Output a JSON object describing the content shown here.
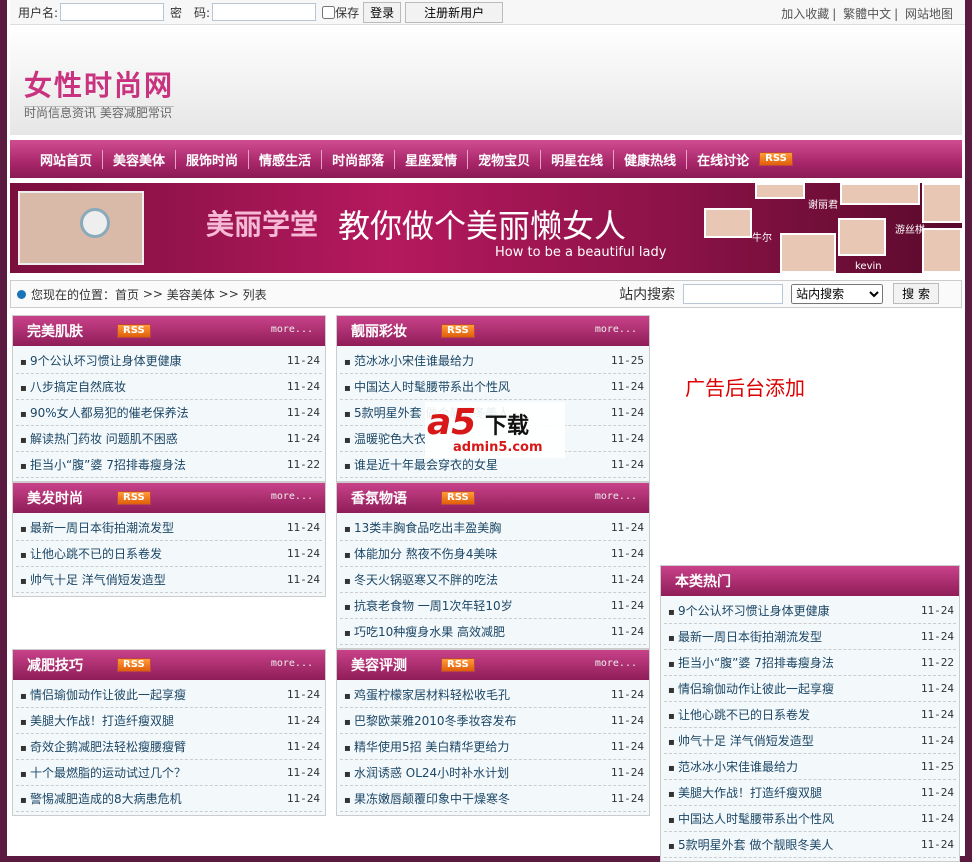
{
  "topbar": {
    "username_label": "用户名:",
    "password_label": "密　码:",
    "remember_label": "保存",
    "login": "登录",
    "register": "注册新用户",
    "links": [
      "加入收藏",
      "繁體中文",
      "网站地图"
    ]
  },
  "header": {
    "logo": "女性时尚网",
    "slogan": "时尚信息资讯 美容减肥常识"
  },
  "nav": {
    "items": [
      "网站首页",
      "美容美体",
      "服饰时尚",
      "情感生活",
      "时尚部落",
      "星座爱情",
      "宠物宝贝",
      "明星在线",
      "健康热线",
      "在线讨论"
    ],
    "rss": "RSS"
  },
  "banner": {
    "title1": "美丽学堂",
    "title2": "教你做个美丽懒女人",
    "subtitle": "How to be a beautiful lady",
    "names": [
      "谢丽君",
      "牛尔",
      "游丝棋",
      "kevin"
    ]
  },
  "breadcrumb": {
    "label": "您现在的位置：",
    "items": [
      "首页",
      "美容美体",
      "列表"
    ],
    "sep": ">>"
  },
  "search": {
    "label": "站内搜索",
    "value": "",
    "select": "站内搜索",
    "button": "搜 索"
  },
  "more": "more...",
  "boxes": [
    {
      "title": "完美肌肤",
      "items": [
        [
          "9个公认坏习惯让身体更健康",
          "11-24"
        ],
        [
          "八步搞定自然底妆",
          "11-24"
        ],
        [
          "90%女人都易犯的催老保养法",
          "11-24"
        ],
        [
          "解读热门药妆 问题肌不困惑",
          "11-24"
        ],
        [
          "拒当小“腹”婆 7招排毒瘦身法",
          "11-22"
        ]
      ]
    },
    {
      "title": "靓丽彩妆",
      "items": [
        [
          "范冰冰小宋佳谁最给力",
          "11-25"
        ],
        [
          "中国达人时髦腰带系出个性风",
          "11-24"
        ],
        [
          "5款明星外套 做个靓眼冬美人",
          "11-24"
        ],
        [
          "温暖驼色大衣",
          "11-24"
        ],
        [
          "谁是近十年最会穿衣的女星",
          "11-24"
        ]
      ]
    },
    {
      "title": "美发时尚",
      "items": [
        [
          "最新一周日本街拍潮流发型",
          "11-24"
        ],
        [
          "让他心跳不已的日系卷发",
          "11-24"
        ],
        [
          "帅气十足 洋气俏短发造型",
          "11-24"
        ]
      ]
    },
    {
      "title": "香氛物语",
      "items": [
        [
          "13类丰胸食品吃出丰盈美胸",
          "11-24"
        ],
        [
          "体能加分 熬夜不伤身4美味",
          "11-24"
        ],
        [
          "冬天火锅驱寒又不胖的吃法",
          "11-24"
        ],
        [
          "抗衰老食物 一周1次年轻10岁",
          "11-24"
        ],
        [
          "巧吃10种瘦身水果 高效减肥",
          "11-24"
        ]
      ]
    },
    {
      "title": "减肥技巧",
      "items": [
        [
          "情侣瑜伽动作让彼此一起享瘦",
          "11-24"
        ],
        [
          "美腿大作战！打造纤瘦双腿",
          "11-24"
        ],
        [
          "奇效企鹅减肥法轻松瘦腰瘦臂",
          "11-24"
        ],
        [
          "十个最燃脂的运动试过几个？",
          "11-24"
        ],
        [
          "警惕减肥造成的8大病患危机",
          "11-24"
        ]
      ]
    },
    {
      "title": "美容评测",
      "items": [
        [
          "鸡蛋柠檬家居材料轻松收毛孔",
          "11-24"
        ],
        [
          "巴黎欧莱雅2010冬季妆容发布",
          "11-24"
        ],
        [
          "精华使用5招 美白精华更给力",
          "11-24"
        ],
        [
          "水润诱惑 OL24小时补水计划",
          "11-24"
        ],
        [
          "果冻嫩唇颠覆印象中干燥寒冬",
          "11-24"
        ]
      ]
    }
  ],
  "ad": "广告后台添加",
  "hot": {
    "title": "本类热门",
    "items": [
      [
        "9个公认坏习惯让身体更健康",
        "11-24"
      ],
      [
        "最新一周日本街拍潮流发型",
        "11-24"
      ],
      [
        "拒当小“腹”婆 7招排毒瘦身法",
        "11-22"
      ],
      [
        "情侣瑜伽动作让彼此一起享瘦",
        "11-24"
      ],
      [
        "让他心跳不已的日系卷发",
        "11-24"
      ],
      [
        "帅气十足 洋气俏短发造型",
        "11-24"
      ],
      [
        "范冰冰小宋佳谁最给力",
        "11-25"
      ],
      [
        "美腿大作战！打造纤瘦双腿",
        "11-24"
      ],
      [
        "中国达人时髦腰带系出个性风",
        "11-24"
      ],
      [
        "5款明星外套 做个靓眼冬美人",
        "11-24"
      ]
    ]
  },
  "watermark": {
    "brand": "a5",
    "text": "下载",
    "url": "admin5.com"
  }
}
